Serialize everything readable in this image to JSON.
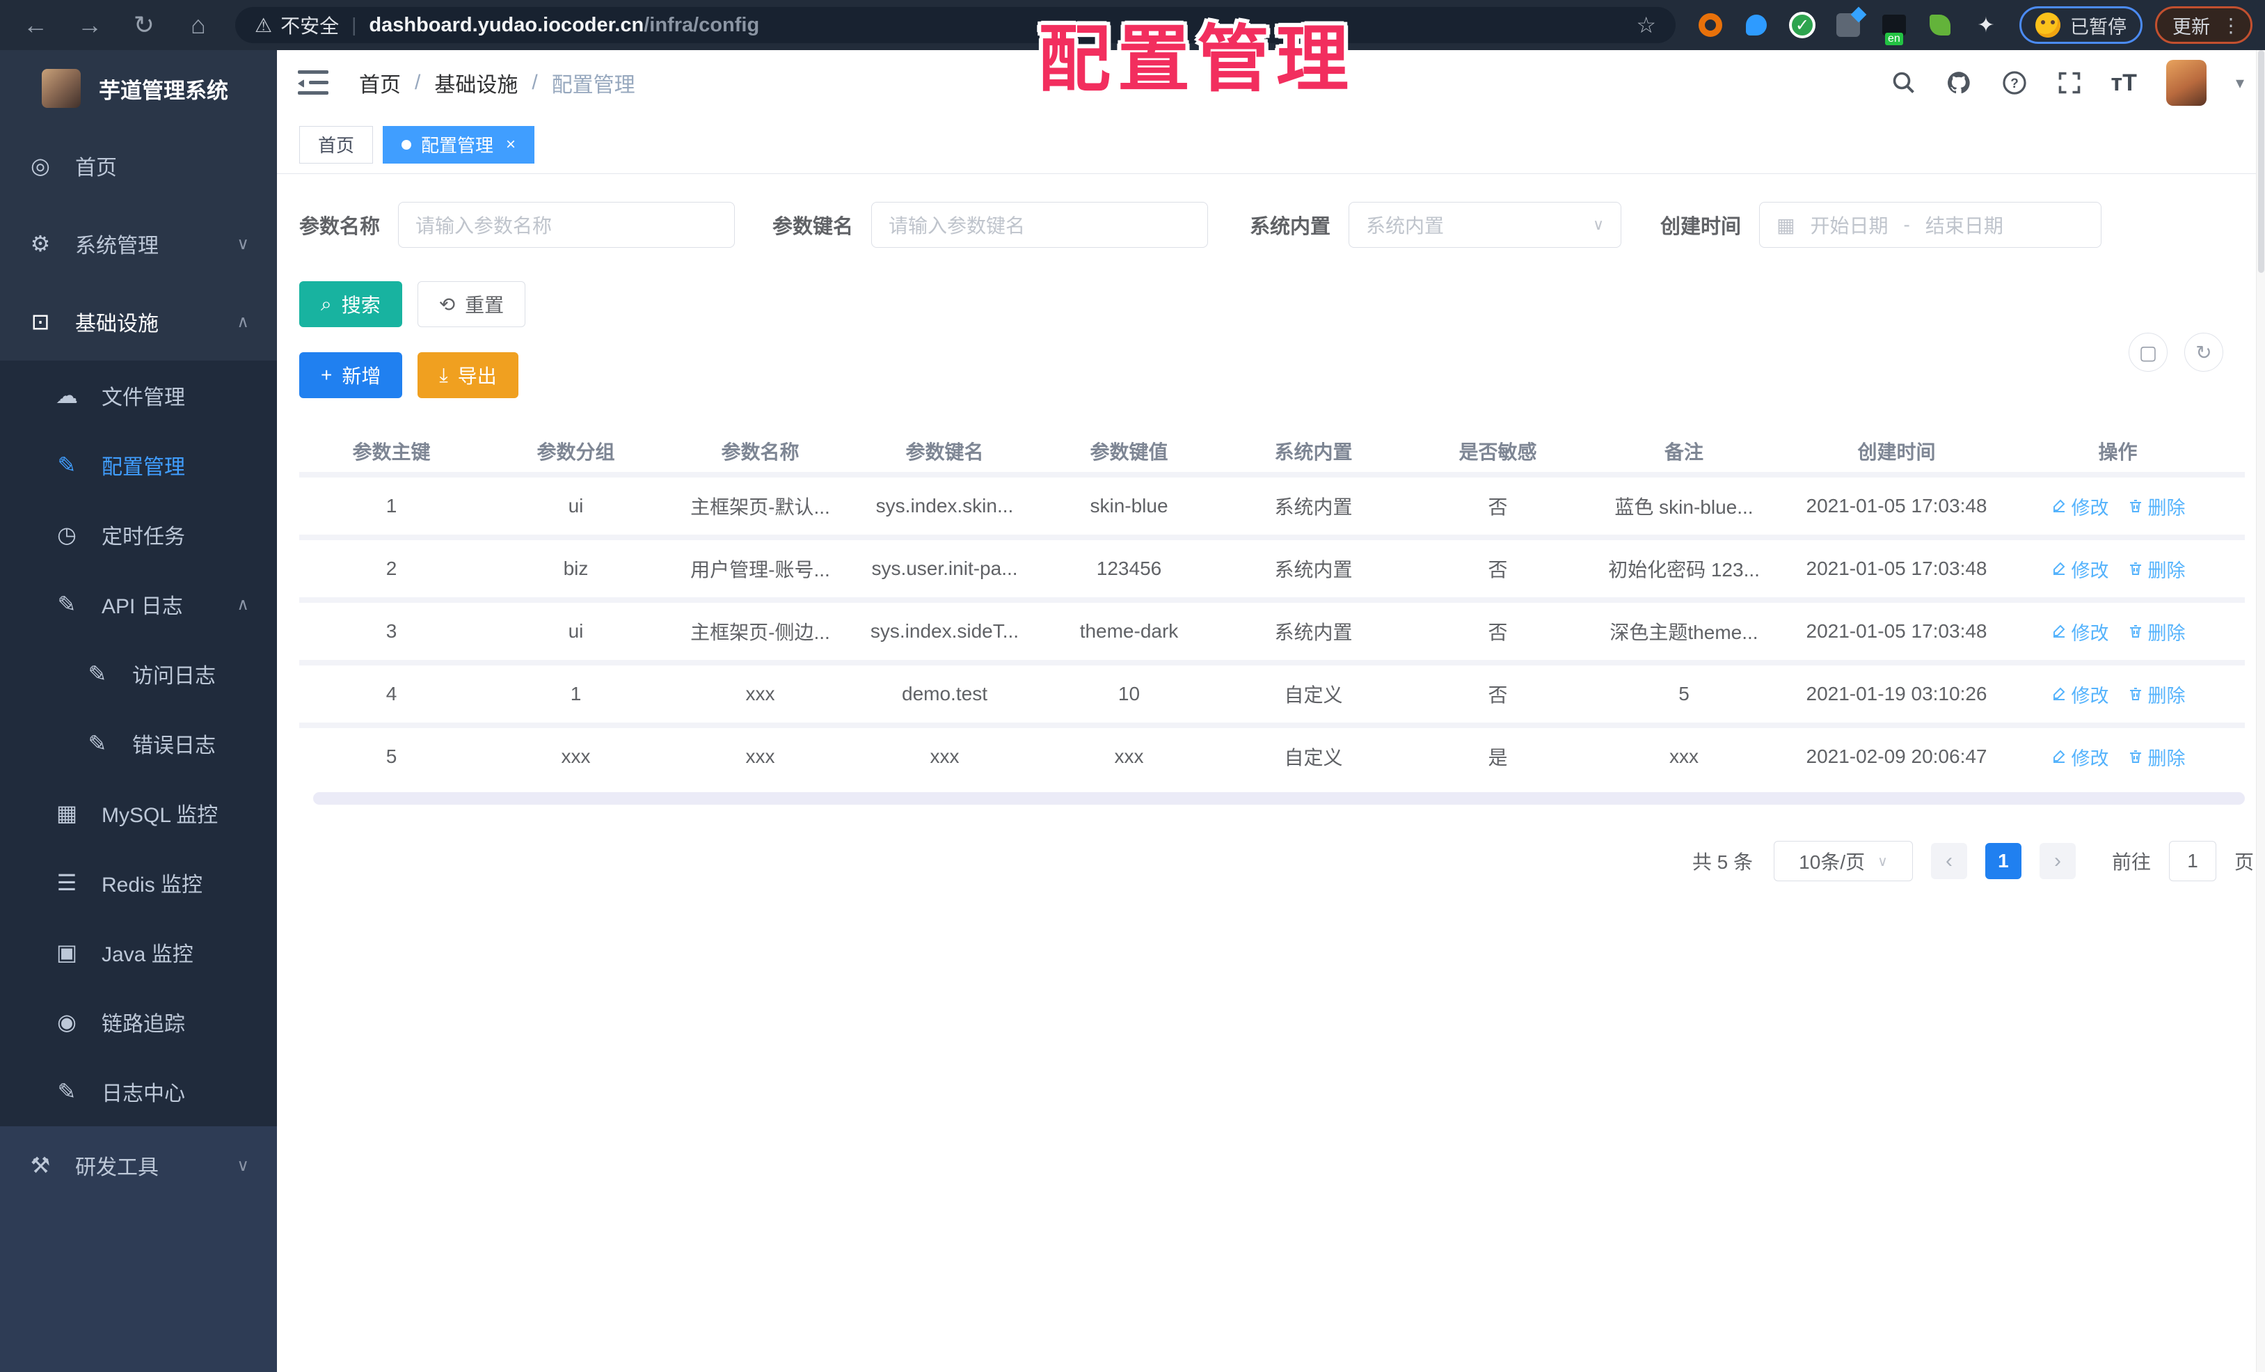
{
  "watermark": "配置管理",
  "browser": {
    "security_label": "不安全",
    "url_host": "dashboard.yudao.iocoder.cn",
    "url_path": "/infra/config",
    "paused_label": "已暂停",
    "update_label": "更新"
  },
  "sidebar": {
    "app_title": "芋道管理系统",
    "items": [
      {
        "label": "首页",
        "icon": "dashboard-icon",
        "type": "top"
      },
      {
        "label": "系统管理",
        "icon": "gear-icon",
        "type": "top",
        "chevron": "down"
      },
      {
        "label": "基础设施",
        "icon": "infra-icon",
        "type": "top",
        "chevron": "up",
        "open": true
      },
      {
        "label": "文件管理",
        "icon": "cloud-icon",
        "type": "sub"
      },
      {
        "label": "配置管理",
        "icon": "config-edit-icon",
        "type": "sub",
        "active": true
      },
      {
        "label": "定时任务",
        "icon": "timer-icon",
        "type": "sub"
      },
      {
        "label": "API 日志",
        "icon": "api-log-icon",
        "type": "sub",
        "chevron": "up"
      },
      {
        "label": "访问日志",
        "icon": "access-log-icon",
        "type": "sub2"
      },
      {
        "label": "错误日志",
        "icon": "error-log-icon",
        "type": "sub2"
      },
      {
        "label": "MySQL 监控",
        "icon": "mysql-icon",
        "type": "sub"
      },
      {
        "label": "Redis 监控",
        "icon": "redis-icon",
        "type": "sub"
      },
      {
        "label": "Java 监控",
        "icon": "java-icon",
        "type": "sub"
      },
      {
        "label": "链路追踪",
        "icon": "trace-icon",
        "type": "sub"
      },
      {
        "label": "日志中心",
        "icon": "log-center-icon",
        "type": "sub"
      },
      {
        "label": "研发工具",
        "icon": "tools-icon",
        "type": "bottom",
        "chevron": "down"
      }
    ]
  },
  "header": {
    "breadcrumb": [
      "首页",
      "基础设施",
      "配置管理"
    ],
    "separator": "/"
  },
  "tabs": [
    {
      "label": "首页",
      "active": false
    },
    {
      "label": "配置管理",
      "active": true
    }
  ],
  "filters": {
    "name_label": "参数名称",
    "name_placeholder": "请输入参数名称",
    "key_label": "参数键名",
    "key_placeholder": "请输入参数键名",
    "type_label": "系统内置",
    "type_placeholder": "系统内置",
    "date_label": "创建时间",
    "date_start_placeholder": "开始日期",
    "date_separator": "-",
    "date_end_placeholder": "结束日期"
  },
  "actions": {
    "search": "搜索",
    "reset": "重置",
    "add": "新增",
    "export": "导出"
  },
  "table": {
    "columns": [
      "参数主键",
      "参数分组",
      "参数名称",
      "参数键名",
      "参数键值",
      "系统内置",
      "是否敏感",
      "备注",
      "创建时间",
      "操作"
    ],
    "edit_label": "修改",
    "delete_label": "删除",
    "rows": [
      [
        "1",
        "ui",
        "主框架页-默认...",
        "sys.index.skin...",
        "skin-blue",
        "系统内置",
        "否",
        "蓝色 skin-blue...",
        "2021-01-05 17:03:48"
      ],
      [
        "2",
        "biz",
        "用户管理-账号...",
        "sys.user.init-pa...",
        "123456",
        "系统内置",
        "否",
        "初始化密码 123...",
        "2021-01-05 17:03:48"
      ],
      [
        "3",
        "ui",
        "主框架页-侧边...",
        "sys.index.sideT...",
        "theme-dark",
        "系统内置",
        "否",
        "深色主题theme...",
        "2021-01-05 17:03:48"
      ],
      [
        "4",
        "1",
        "xxx",
        "demo.test",
        "10",
        "自定义",
        "否",
        "5",
        "2021-01-19 03:10:26"
      ],
      [
        "5",
        "xxx",
        "xxx",
        "xxx",
        "xxx",
        "自定义",
        "是",
        "xxx",
        "2021-02-09 20:06:47"
      ]
    ]
  },
  "pagination": {
    "total": "共 5 条",
    "page_size": "10条/页",
    "current": "1",
    "goto_label": "前往",
    "goto_value": "1",
    "page_label": "页"
  },
  "colors": {
    "accent_blue": "#409eff",
    "primary_blue": "#2080f0",
    "teal": "#18b3a0",
    "amber": "#f0a020",
    "link_blue": "#55b3fc",
    "watermark_pink": "#f22e5e"
  }
}
